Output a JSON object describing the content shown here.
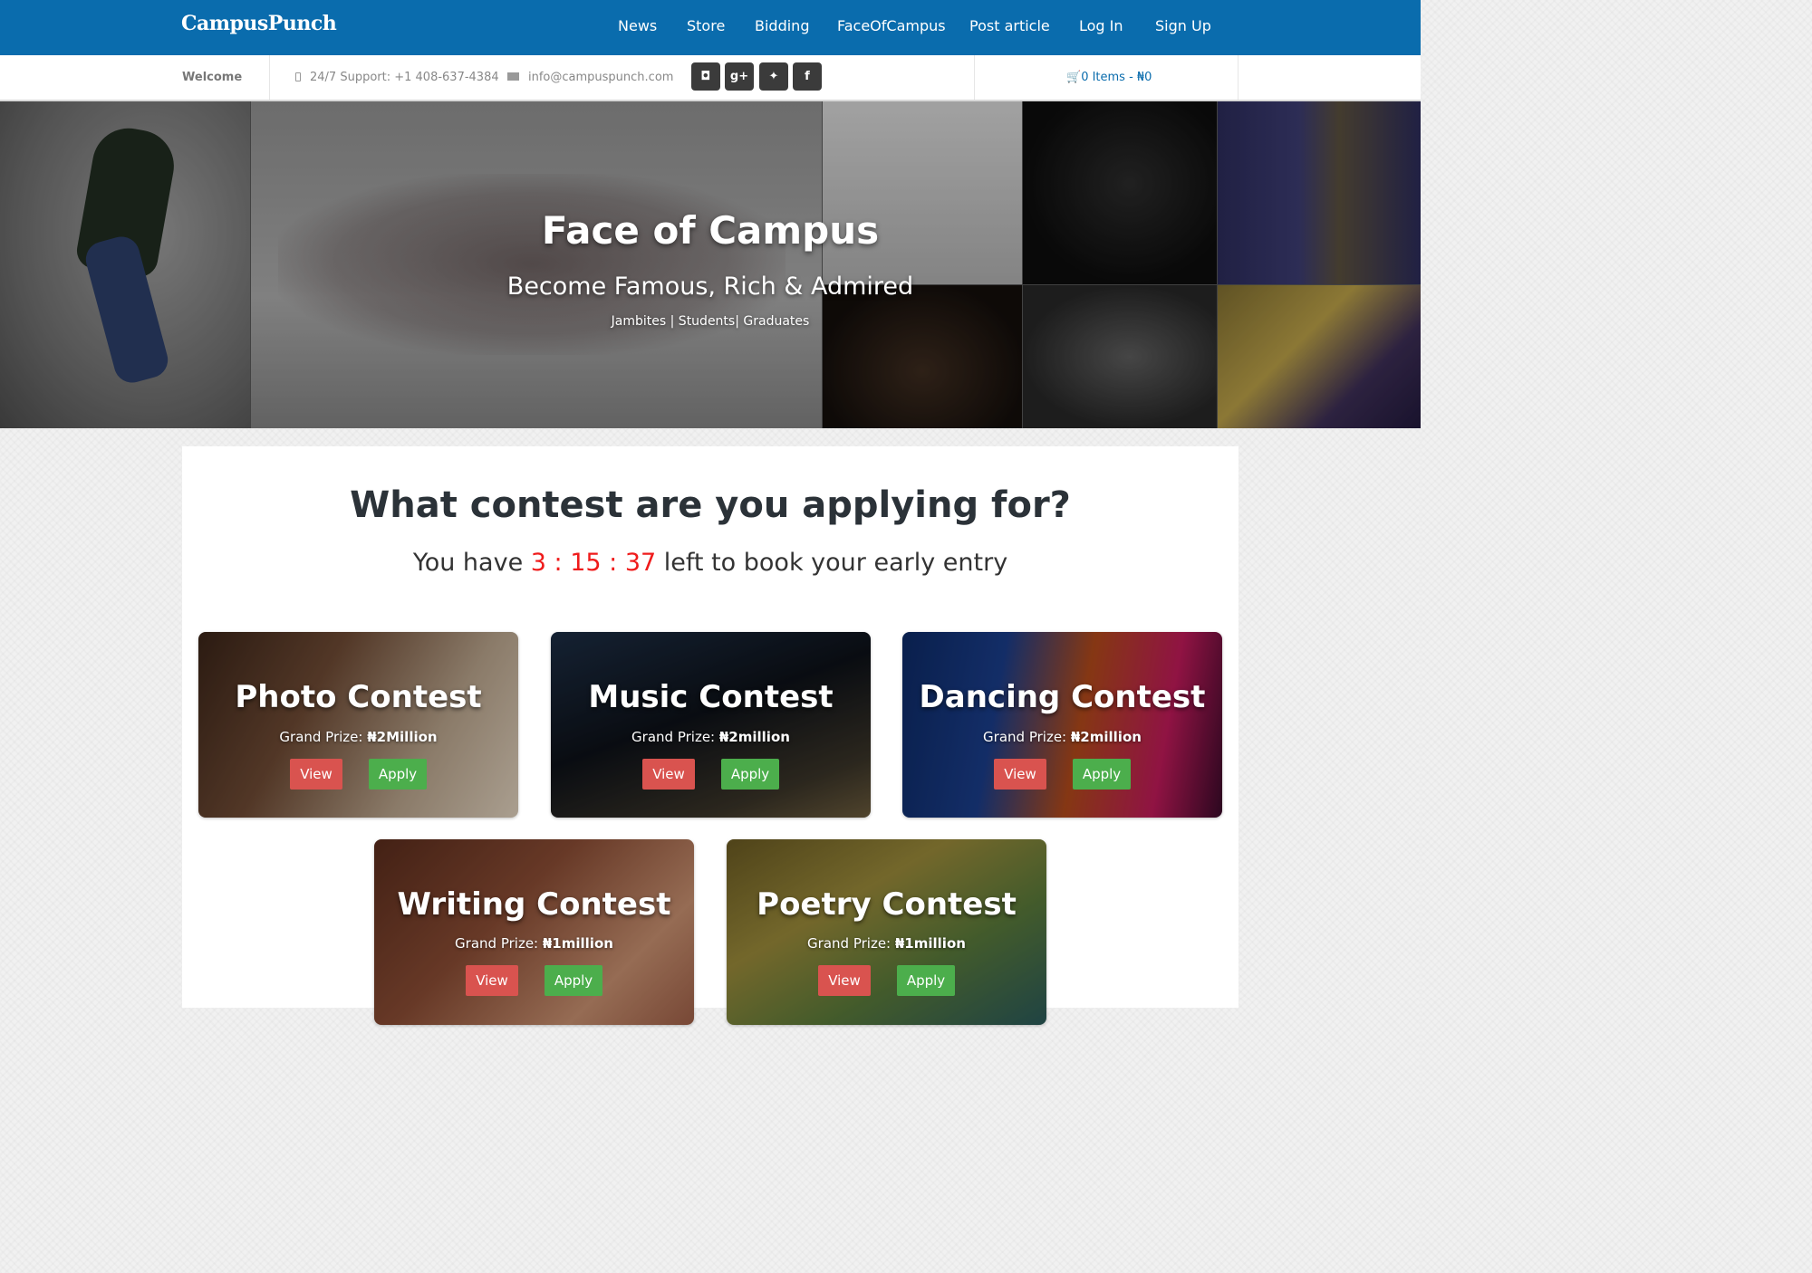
{
  "brand": {
    "logo": "CampusPunch",
    "accent": "#0a6cad"
  },
  "nav": {
    "items": [
      "News",
      "Store",
      "Bidding",
      "FaceOfCampus",
      "Post article",
      "Log In",
      "Sign Up"
    ]
  },
  "infobar": {
    "welcome": "Welcome",
    "support": "24/7 Support: +1 408-637-4384",
    "email": "info@campuspunch.com",
    "social": [
      {
        "icon": "instagram-icon",
        "glyph": "◘"
      },
      {
        "icon": "google-plus-icon",
        "glyph": "g+"
      },
      {
        "icon": "twitter-icon",
        "glyph": "✦"
      },
      {
        "icon": "facebook-icon",
        "glyph": "f"
      }
    ],
    "cart": "0 Items - ₦0"
  },
  "hero": {
    "title": "Face of Campus",
    "subtitle": "Become Famous, Rich & Admired",
    "tagline": "Jambites | Students| Graduates"
  },
  "main": {
    "heading": "What contest are you applying for?",
    "countdown_prefix": "You have ",
    "countdown": "3 : 15 : 37",
    "countdown_suffix": " left to book your early entry",
    "countdown_color": "#ef1b1b"
  },
  "contests": [
    {
      "title": "Photo Contest",
      "prize_label": "Grand Prize: ",
      "prize": "₦2Million",
      "view": "View",
      "apply": "Apply"
    },
    {
      "title": "Music Contest",
      "prize_label": "Grand Prize: ",
      "prize": "₦2million",
      "view": "View",
      "apply": "Apply"
    },
    {
      "title": "Dancing Contest",
      "prize_label": "Grand Prize: ",
      "prize": "₦2million",
      "view": "View",
      "apply": "Apply"
    },
    {
      "title": "Writing Contest",
      "prize_label": "Grand Prize: ",
      "prize": "₦1million",
      "view": "View",
      "apply": "Apply"
    },
    {
      "title": "Poetry Contest",
      "prize_label": "Grand Prize: ",
      "prize": "₦1million",
      "view": "View",
      "apply": "Apply"
    }
  ]
}
